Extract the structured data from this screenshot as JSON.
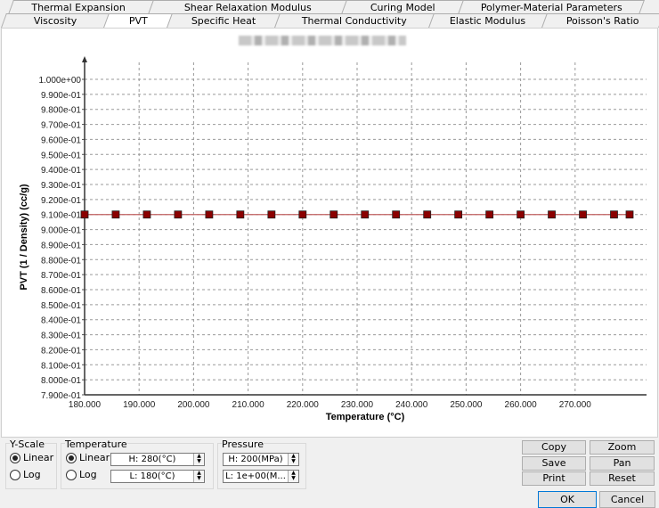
{
  "tabs_row1": [
    "Thermal Expansion Coefficient",
    "Shear Relaxation Modulus",
    "Curing Model",
    "Polymer-Material Parameters"
  ],
  "tabs_row2": [
    "Viscosity",
    "PVT",
    "Specific Heat",
    "Thermal Conductivity",
    "Elastic Modulus",
    "Poisson's Ratio"
  ],
  "active_tab": "PVT",
  "chart_data": {
    "type": "line",
    "title": "",
    "xlabel": "Temperature (°C)",
    "ylabel": "PVT (1 / Density) (cc/g)",
    "xlim": [
      180,
      282
    ],
    "ylim": [
      0.79,
      1.0
    ],
    "x_ticks": [
      "180.000",
      "190.000",
      "200.000",
      "210.000",
      "220.000",
      "230.000",
      "240.000",
      "250.000",
      "260.000",
      "270.000"
    ],
    "y_ticks": [
      "7.900e-01",
      "8.000e-01",
      "8.100e-01",
      "8.200e-01",
      "8.300e-01",
      "8.400e-01",
      "8.500e-01",
      "8.600e-01",
      "8.700e-01",
      "8.800e-01",
      "8.900e-01",
      "9.000e-01",
      "9.100e-01",
      "9.200e-01",
      "9.300e-01",
      "9.400e-01",
      "9.500e-01",
      "9.600e-01",
      "9.700e-01",
      "9.800e-01",
      "9.900e-01",
      "1.000e+00"
    ],
    "grid": true,
    "series": [
      {
        "name": "PVT",
        "color": "#8b0000",
        "x": [
          180,
          185.71,
          191.43,
          197.14,
          202.86,
          208.57,
          214.29,
          220,
          225.71,
          231.43,
          237.14,
          242.86,
          248.57,
          254.29,
          260,
          265.71,
          271.43,
          277.14,
          280
        ],
        "y": [
          0.91,
          0.91,
          0.91,
          0.91,
          0.91,
          0.91,
          0.91,
          0.91,
          0.91,
          0.91,
          0.91,
          0.91,
          0.91,
          0.91,
          0.91,
          0.91,
          0.91,
          0.91,
          0.91
        ]
      }
    ]
  },
  "yscale": {
    "label": "Y-Scale",
    "linear": "Linear",
    "log": "Log",
    "selected": "Linear"
  },
  "temperature": {
    "label": "Temperature",
    "linear": "Linear",
    "log": "Log",
    "selected": "Linear",
    "high": "H: 280(°C)",
    "low": "L: 180(°C)"
  },
  "pressure": {
    "label": "Pressure",
    "high": "H: 200(MPa)",
    "low": "L: 1e+00(M..."
  },
  "buttons": {
    "copy": "Copy",
    "zoom": "Zoom",
    "save": "Save",
    "pan": "Pan",
    "print": "Print",
    "reset": "Reset",
    "ok": "OK",
    "cancel": "Cancel"
  }
}
